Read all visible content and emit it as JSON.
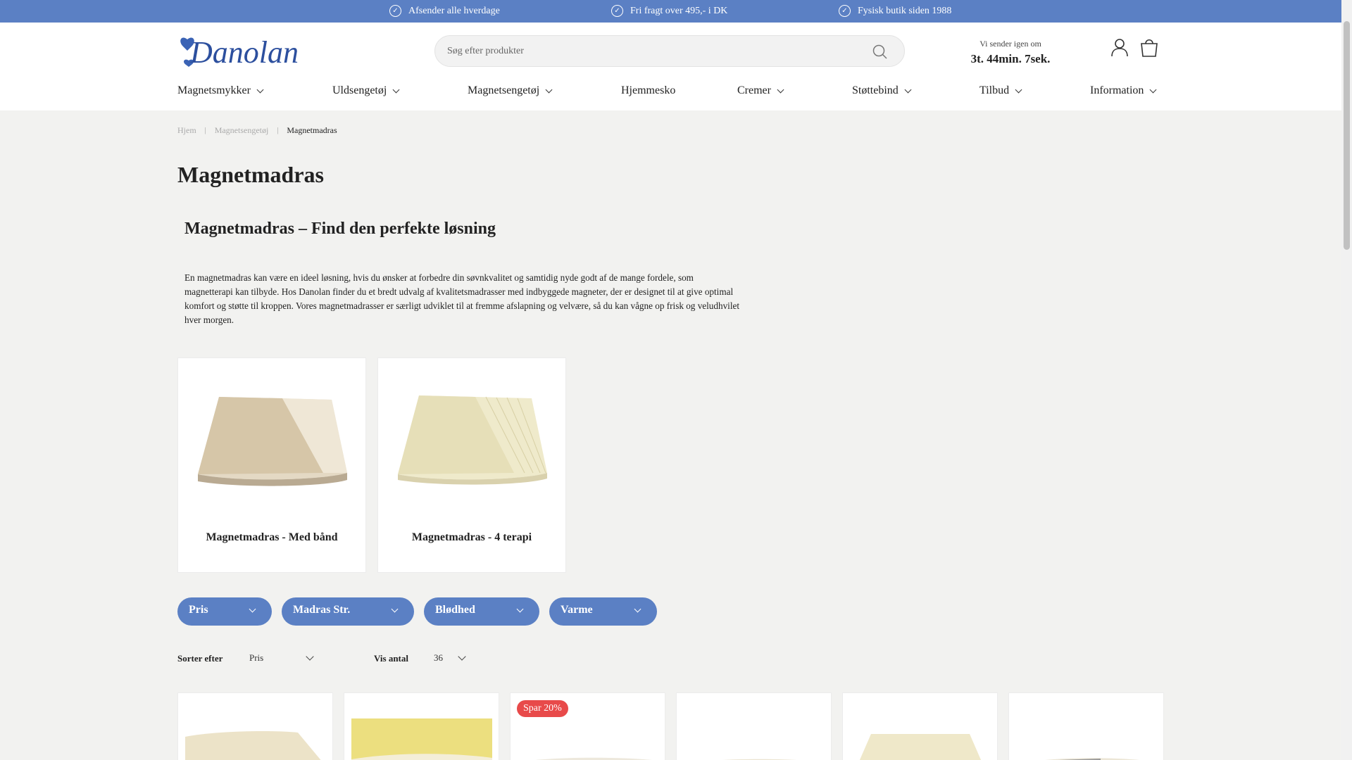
{
  "topbar": {
    "usps": [
      "Afsender alle hverdage",
      "Fri fragt over 495,- i DK",
      "Fysisk butik siden 1988"
    ]
  },
  "header": {
    "logo_text": "Danolan",
    "search_placeholder": "Søg efter produkter",
    "timer_label": "Vi sender igen om",
    "timer_value": "3t. 44min. 7sek."
  },
  "nav": {
    "items": [
      {
        "label": "Magnetsmykker",
        "has_caret": true
      },
      {
        "label": "Uldsengetøj",
        "has_caret": true
      },
      {
        "label": "Magnetsengetøj",
        "has_caret": true
      },
      {
        "label": "Hjemmesko",
        "has_caret": false
      },
      {
        "label": "Cremer",
        "has_caret": true
      },
      {
        "label": "Støttebind",
        "has_caret": true
      },
      {
        "label": "Tilbud",
        "has_caret": true
      },
      {
        "label": "Information",
        "has_caret": true
      }
    ]
  },
  "breadcrumb": {
    "items": [
      "Hjem",
      "Magnetsengetøj",
      "Magnetmadras"
    ],
    "separator": "|"
  },
  "page": {
    "title": "Magnetmadras",
    "subtitle": "Magnetmadras – Find den perfekte løsning",
    "intro": "En magnetmadras kan være en ideel løsning, hvis du ønsker at forbedre din søvnkvalitet og samtidig nyde godt af de mange fordele, som magnetterapi kan tilbyde. Hos Danolan finder du et bredt udvalg af kvalitetsmadrasser med indbyggede magneter, der er designet til at give optimal komfort og støtte til kroppen. Vores magnetmadrasser er særligt udviklet til at fremme afslapning og velvære, så du kan vågne op frisk og veludhvilet hver morgen."
  },
  "categories": [
    {
      "title": "Magnetmadras - Med bånd"
    },
    {
      "title": "Magnetmadras - 4 terapi"
    }
  ],
  "filters": [
    "Pris",
    "Madras Str.",
    "Blødhed",
    "Varme"
  ],
  "sorting": {
    "sort_label": "Sorter efter",
    "sort_value": "Pris",
    "count_label": "Vis antal",
    "count_value": "36"
  },
  "products": [
    {
      "badge": ""
    },
    {
      "badge": ""
    },
    {
      "badge": "Spar 20%"
    },
    {
      "badge": ""
    },
    {
      "badge": ""
    },
    {
      "badge": ""
    }
  ],
  "colors": {
    "accent": "#5b80c4",
    "badge": "#e84a4a",
    "background": "#f2f2f0"
  }
}
